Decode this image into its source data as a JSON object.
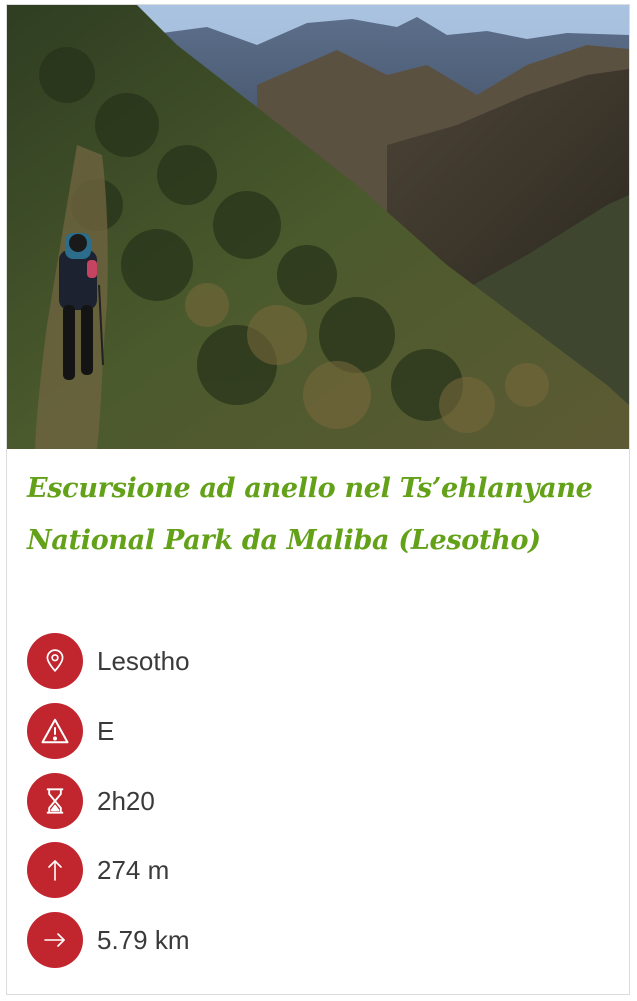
{
  "hike": {
    "title": "Escursione ad anello nel Ts’ehlanyane National Park da Maliba (Lesotho)",
    "photo_alt": "Escursionista su un sentiero di montagna",
    "colors": {
      "title": "#62a118",
      "icon_bg": "#c1262f",
      "text": "#3a3a3a"
    },
    "details": [
      {
        "icon": "location-pin-icon",
        "value": "Lesotho"
      },
      {
        "icon": "warning-triangle-icon",
        "value": "E"
      },
      {
        "icon": "hourglass-icon",
        "value": "2h20"
      },
      {
        "icon": "arrow-up-icon",
        "value": "274 m"
      },
      {
        "icon": "arrow-right-icon",
        "value": "5.79 km"
      }
    ]
  }
}
